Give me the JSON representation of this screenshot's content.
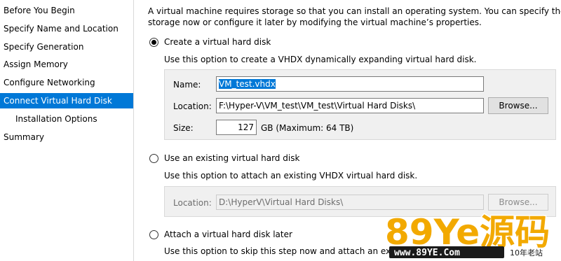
{
  "sidebar": {
    "items": [
      {
        "label": "Before You Begin"
      },
      {
        "label": "Specify Name and Location"
      },
      {
        "label": "Specify Generation"
      },
      {
        "label": "Assign Memory"
      },
      {
        "label": "Configure Networking"
      },
      {
        "label": "Connect Virtual Hard Disk"
      },
      {
        "label": "Installation Options"
      },
      {
        "label": "Summary"
      }
    ],
    "active_index": 5
  },
  "intro": {
    "line1": "A virtual machine requires storage so that you can install an operating system. You can specify the",
    "line2": "storage now or configure it later by modifying the virtual machine’s properties."
  },
  "create_option": {
    "label": "Create a virtual hard disk",
    "description": "Use this option to create a VHDX dynamically expanding virtual hard disk.",
    "selected": true,
    "name_label": "Name:",
    "name_value": "VM_test.vhdx",
    "location_label": "Location:",
    "location_value": "F:\\Hyper-V\\VM_test\\VM_test\\Virtual Hard Disks\\",
    "browse_label": "Browse...",
    "size_label": "Size:",
    "size_value": "127",
    "size_unit": "GB (Maximum: 64 TB)"
  },
  "existing_option": {
    "label": "Use an existing virtual hard disk",
    "description": "Use this option to attach an existing VHDX virtual hard disk.",
    "selected": false,
    "location_label": "Location:",
    "location_value": "D:\\HyperV\\Virtual Hard Disks\\",
    "browse_label": "Browse..."
  },
  "later_option": {
    "label": "Attach a virtual hard disk later",
    "description": "Use this option to skip this step now and attach an exis",
    "selected": false
  },
  "watermark": {
    "logo": "89Ye源码",
    "url": "www.89YE.Com",
    "tag": "10年老站"
  },
  "colors": {
    "accent": "#0078d7",
    "watermark_gold": "#f2a900"
  }
}
